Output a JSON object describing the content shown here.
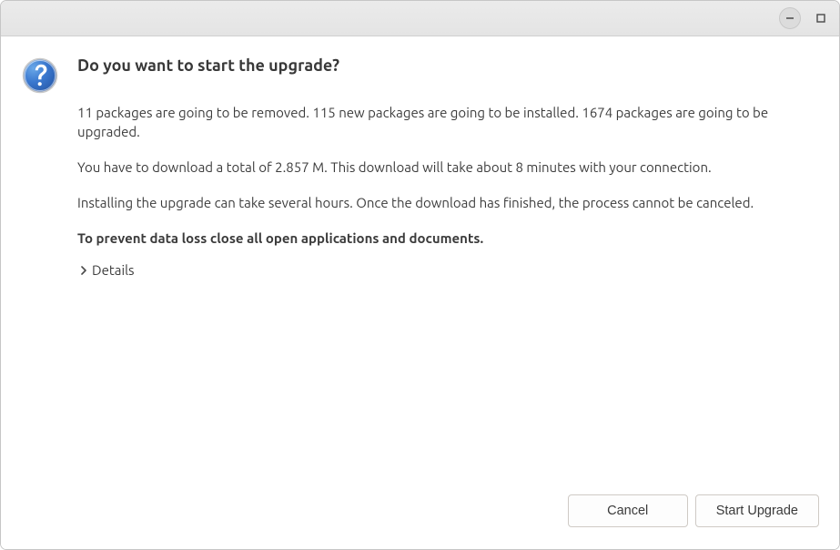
{
  "dialog": {
    "title": "Do you want to start the upgrade?",
    "packages_line": "11 packages are going to be removed. 115 new packages are going to be installed. 1674 packages are going to be upgraded.",
    "download_line": "You have to download a total of 2.857 M. This download will take about 8 minutes with your connection.",
    "install_line": "Installing the upgrade can take several hours. Once the download has finished, the process cannot be canceled.",
    "warning_line": "To prevent data loss close all open applications and documents.",
    "details_label": "Details"
  },
  "buttons": {
    "cancel": "Cancel",
    "start_upgrade": "Start Upgrade"
  }
}
